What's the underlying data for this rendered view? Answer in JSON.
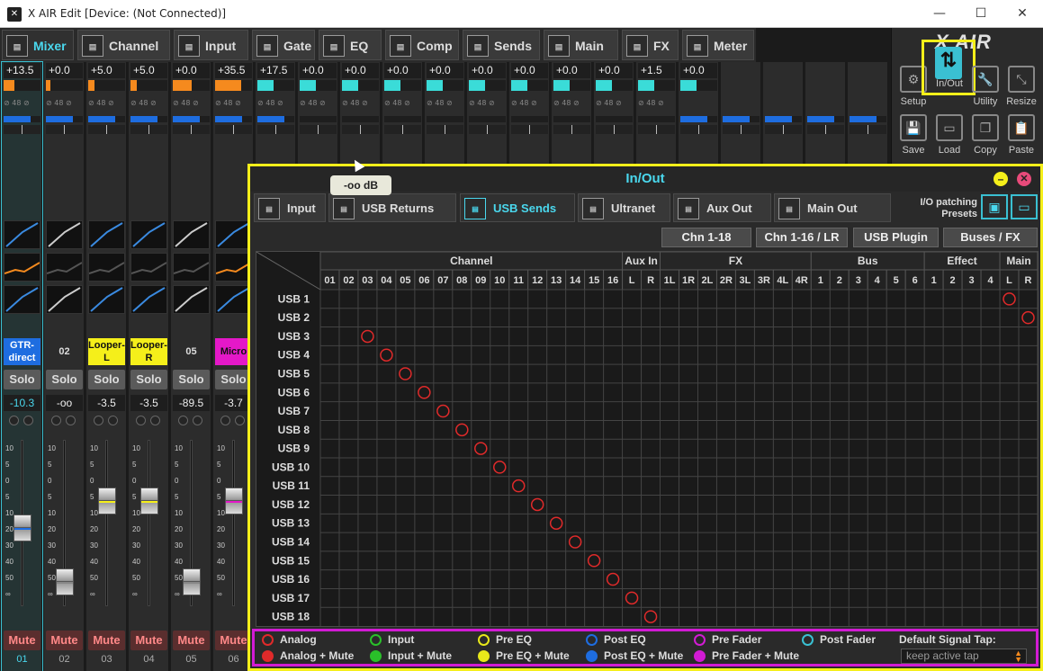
{
  "window": {
    "title": "X AIR Edit [Device: (Not Connected)]",
    "minimize": "—",
    "maximize": "☐",
    "close": "✕"
  },
  "top_tabs": [
    {
      "label": "Mixer",
      "icon": "mixer-icon"
    },
    {
      "label": "Channel",
      "icon": "channel-icon"
    },
    {
      "label": "Input",
      "icon": "input-icon"
    },
    {
      "label": "Gate",
      "icon": "gate-icon"
    },
    {
      "label": "EQ",
      "icon": "eq-icon"
    },
    {
      "label": "Comp",
      "icon": "comp-icon"
    },
    {
      "label": "Sends",
      "icon": "sends-icon"
    },
    {
      "label": "Main",
      "icon": "main-icon"
    },
    {
      "label": "FX",
      "icon": "fx-icon"
    },
    {
      "label": "Meter",
      "icon": "meter-icon"
    }
  ],
  "right_panel": {
    "brand": "X AIR",
    "buttons": [
      {
        "label": "Setup",
        "icon": "gear-icon"
      },
      {
        "label": "In/Out",
        "icon": "inout-icon"
      },
      {
        "label": "Utility",
        "icon": "wrench-icon"
      },
      {
        "label": "Resize",
        "icon": "resize-icon"
      },
      {
        "label": "Save",
        "icon": "save-icon"
      },
      {
        "label": "Load",
        "icon": "folder-icon"
      },
      {
        "label": "Copy",
        "icon": "copy-icon"
      },
      {
        "label": "Paste",
        "icon": "paste-icon"
      }
    ]
  },
  "strips": [
    {
      "gain": "+13.5",
      "gain_frac": 0.3,
      "name": "GTR-\ndirect",
      "name_color": "#1e6de0",
      "name_text": "#ffffff",
      "level": "-10.3",
      "number": "01",
      "fader": 0.55,
      "fader_color": "#1e6de0",
      "selected": true
    },
    {
      "gain": "+0.0",
      "gain_frac": 0.12,
      "name": "02",
      "name_color": "",
      "name_text": "#dddddd",
      "level": "-oo",
      "number": "02",
      "fader": 0.95,
      "fader_color": "",
      "selected": false
    },
    {
      "gain": "+5.0",
      "gain_frac": 0.18,
      "name": "Looper-\nL",
      "name_color": "#f5ef1a",
      "name_text": "#111111",
      "level": "-3.5",
      "number": "03",
      "fader": 0.35,
      "fader_color": "#f5ef1a",
      "selected": false
    },
    {
      "gain": "+5.0",
      "gain_frac": 0.18,
      "name": "Looper-\nR",
      "name_color": "#f5ef1a",
      "name_text": "#111111",
      "level": "-3.5",
      "number": "04",
      "fader": 0.35,
      "fader_color": "#f5ef1a",
      "selected": false
    },
    {
      "gain": "+0.0",
      "gain_frac": 0.5,
      "name": "05",
      "name_color": "",
      "name_text": "#dddddd",
      "level": "-89.5",
      "number": "05",
      "fader": 0.95,
      "fader_color": "",
      "selected": false
    },
    {
      "gain": "+35.5",
      "gain_frac": 0.7,
      "name": "Micro",
      "name_color": "#e418c8",
      "name_text": "#111111",
      "level": "-3.7",
      "number": "06",
      "fader": 0.35,
      "fader_color": "#e418c8",
      "selected": false
    }
  ],
  "extra_gains": [
    "+17.5",
    "+0.0",
    "+0.0",
    "+0.0",
    "+0.0",
    "+0.0",
    "+0.0",
    "+0.0",
    "+0.0",
    "+1.5",
    "+0.0"
  ],
  "strip_labels": {
    "solo": "Solo",
    "mute": "Mute",
    "phantom": "48"
  },
  "fader_scale": [
    "10",
    "5",
    "0",
    "5",
    "10",
    "20",
    "30",
    "40",
    "50",
    "∞"
  ],
  "tooltip": "-oo dB",
  "inout": {
    "title": "In/Out",
    "tabs": [
      {
        "label": "Input",
        "icon": "input-icon",
        "active": false
      },
      {
        "label": "USB Returns",
        "icon": "usb-returns-icon",
        "active": false
      },
      {
        "label": "USB Sends",
        "icon": "usb-sends-icon",
        "active": true
      },
      {
        "label": "Ultranet",
        "icon": "ultranet-icon",
        "active": false
      },
      {
        "label": "Aux Out",
        "icon": "aux-out-icon",
        "active": false
      },
      {
        "label": "Main Out",
        "icon": "main-out-icon",
        "active": false
      }
    ],
    "presets_label": "I/O patching\nPresets",
    "header_buttons": [
      "Chn 1-18",
      "Chn 1-16 / LR",
      "USB Plugin",
      "Buses / FX"
    ],
    "groups": [
      {
        "label": "Channel",
        "cols": [
          "01",
          "02",
          "03",
          "04",
          "05",
          "06",
          "07",
          "08",
          "09",
          "10",
          "11",
          "12",
          "13",
          "14",
          "15",
          "16"
        ]
      },
      {
        "label": "Aux In",
        "cols": [
          "L",
          "R"
        ]
      },
      {
        "label": "FX",
        "cols": [
          "1L",
          "1R",
          "2L",
          "2R",
          "3L",
          "3R",
          "4L",
          "4R"
        ]
      },
      {
        "label": "Bus",
        "cols": [
          "1",
          "2",
          "3",
          "4",
          "5",
          "6"
        ]
      },
      {
        "label": "Effect",
        "cols": [
          "1",
          "2",
          "3",
          "4"
        ]
      },
      {
        "label": "Main",
        "cols": [
          "L",
          "R"
        ]
      }
    ],
    "rows": [
      "USB 1",
      "USB 2",
      "USB 3",
      "USB 4",
      "USB 5",
      "USB 6",
      "USB 7",
      "USB 8",
      "USB 9",
      "USB 10",
      "USB 11",
      "USB 12",
      "USB 13",
      "USB 14",
      "USB 15",
      "USB 16",
      "USB 17",
      "USB 18"
    ],
    "patches": [
      [
        0,
        36
      ],
      [
        1,
        37
      ],
      [
        2,
        2
      ],
      [
        3,
        3
      ],
      [
        4,
        4
      ],
      [
        5,
        5
      ],
      [
        6,
        6
      ],
      [
        7,
        7
      ],
      [
        8,
        8
      ],
      [
        9,
        9
      ],
      [
        10,
        10
      ],
      [
        11,
        11
      ],
      [
        12,
        12
      ],
      [
        13,
        13
      ],
      [
        14,
        14
      ],
      [
        15,
        15
      ],
      [
        16,
        16
      ],
      [
        17,
        17
      ]
    ],
    "patch_color": "#e02a2a",
    "legend": [
      {
        "label": "Analog",
        "color": "#e02a2a",
        "filled": false
      },
      {
        "label": "Analog + Mute",
        "color": "#e02a2a",
        "filled": true
      },
      {
        "label": "Input",
        "color": "#2ac02a",
        "filled": false
      },
      {
        "label": "Input + Mute",
        "color": "#2ac02a",
        "filled": true
      },
      {
        "label": "Pre EQ",
        "color": "#e8e81a",
        "filled": false
      },
      {
        "label": "Pre EQ + Mute",
        "color": "#e8e81a",
        "filled": true
      },
      {
        "label": "Post EQ",
        "color": "#1e6de0",
        "filled": false
      },
      {
        "label": "Post EQ + Mute",
        "color": "#1e6de0",
        "filled": true
      },
      {
        "label": "Pre Fader",
        "color": "#d21bd4",
        "filled": false
      },
      {
        "label": "Pre Fader + Mute",
        "color": "#d21bd4",
        "filled": true
      },
      {
        "label": "Post Fader",
        "color": "#3ac0d2",
        "filled": false
      }
    ],
    "default_tap_label": "Default Signal Tap:",
    "default_tap_value": "keep active tap"
  }
}
